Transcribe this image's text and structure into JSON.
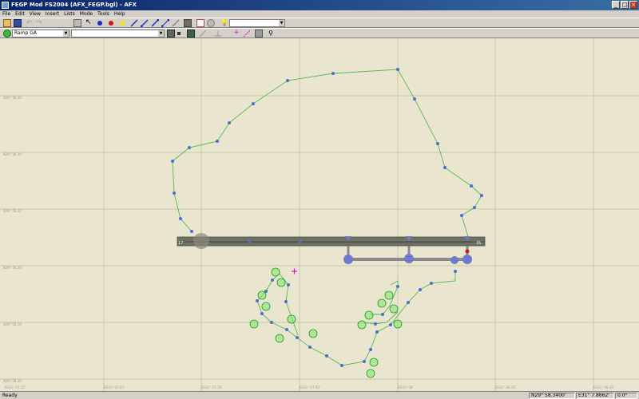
{
  "window": {
    "title": "FEGP Mod FS2004 (AFX_FEGP.bgl) - AFX"
  },
  "menu": {
    "items": [
      "File",
      "Edit",
      "View",
      "Insert",
      "Lists",
      "Mode",
      "Tools",
      "Help"
    ]
  },
  "toolbar": {
    "layer_select": "",
    "colors": {
      "blue": "#1a2ad8",
      "red": "#e01010",
      "yellow": "#f0e020"
    }
  },
  "toolbar2": {
    "parking_type": "Ramp GA",
    "secondary_select": ""
  },
  "map": {
    "lat_labels": [
      "N29° 58.36'",
      "N29° 58.34'",
      "N29° 58.32'",
      "N29° 58.30'",
      "N29° 58.28'",
      "N29° 58.26'"
    ],
    "lon_labels": [
      "E031° 07.52'",
      "E031° 07.65'",
      "E031° 07.78'",
      "E031° 07.90'",
      "E031° 08'",
      "E031° 08.16'",
      "E031° 08.29'"
    ],
    "runway_end_left": "17",
    "runway_end_right": "35",
    "colors": {
      "grass": "#e9e5cf",
      "taxi_line": "#5ab84a",
      "node": "#4a6fd0",
      "runway": "#6e7266",
      "parking": "#44dd44"
    }
  },
  "status": {
    "ready": "Ready",
    "lat": "N29° 58.3400'",
    "lon": "E31° 7.8662'",
    "heading": "0.0°"
  }
}
